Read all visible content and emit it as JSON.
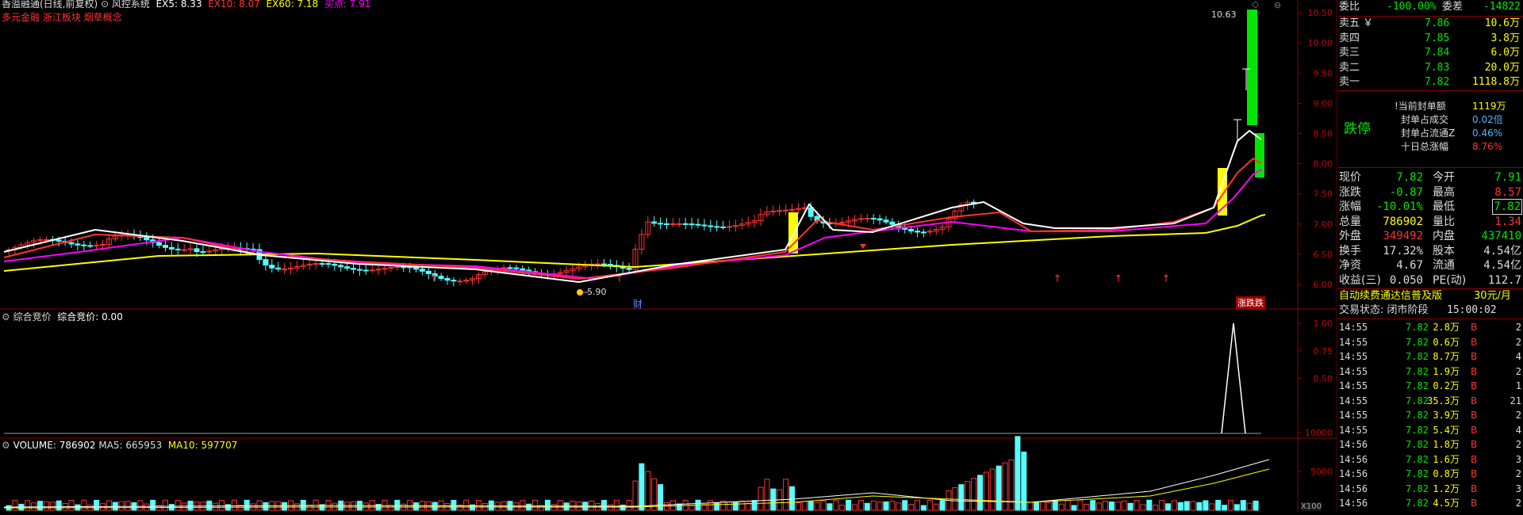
{
  "header": {
    "stock_name": "香溢融通(日线,前复权)",
    "system_icon_label": "风控系统",
    "ex5": "EX5: 8.33",
    "ex10": "EX10: 8.07",
    "ex60": "EX60: 7.18",
    "buy_sell": "买点: 7.91",
    "concepts": "多元金融 浙江板块 烟草概念"
  },
  "main_chart": {
    "y_ticks": [
      "10.50",
      "10.00",
      "9.50",
      "9.00",
      "8.50",
      "8.00",
      "7.50",
      "7.00",
      "6.50",
      "6.00"
    ],
    "high_label": "10.63",
    "low_label": "5.90",
    "cai_marker": "财",
    "limit_tag": "涨跌跌"
  },
  "auction_panel": {
    "title": "综合竞价",
    "value_label": "综合竞价: 0.00",
    "y_ticks": [
      "1.00",
      "0.75",
      "0.50"
    ]
  },
  "volume_panel": {
    "vol": "VOLUME: 786902",
    "ma5": "MA5: 665953",
    "ma10": "MA10: 597707",
    "y_ticks": [
      "10000",
      "5000"
    ],
    "unit": "X100"
  },
  "colors": {
    "up": "#ff3232",
    "down": "#54ffff",
    "ma5": "#ffffff",
    "ma10": "#ff3232",
    "ma20": "#ff00ff",
    "ma60": "#ffff00",
    "green": "#00e600"
  },
  "order_book": {
    "weibi_label": "委比",
    "weibi_value": "-100.00%",
    "weicha_label": "委差",
    "weicha_value": "-14822",
    "asks": [
      {
        "label": "卖五",
        "price": "7.86",
        "vol": "10.6万"
      },
      {
        "label": "卖四",
        "price": "7.85",
        "vol": "3.8万"
      },
      {
        "label": "卖三",
        "price": "7.84",
        "vol": "6.0万"
      },
      {
        "label": "卖二",
        "price": "7.83",
        "vol": "20.0万"
      },
      {
        "label": "卖一",
        "price": "7.82",
        "vol": "1118.8万"
      }
    ],
    "status_big": "跌停",
    "seal_info": [
      {
        "label": "当前封单额",
        "value": "1119万"
      },
      {
        "label": "封单占成交",
        "value": "0.02倍"
      },
      {
        "label": "封单占流通Z",
        "value": "0.46%"
      },
      {
        "label": "十日总涨幅",
        "value": "8.76%"
      }
    ]
  },
  "quote": {
    "rows": [
      {
        "l1": "现价",
        "v1": "7.82",
        "l2": "今开",
        "v2": "7.91"
      },
      {
        "l1": "涨跌",
        "v1": "-0.87",
        "l2": "最高",
        "v2": "8.57"
      },
      {
        "l1": "涨幅",
        "v1": "-10.01%",
        "l2": "最低",
        "v2": "7.82"
      },
      {
        "l1": "总量",
        "v1": "786902",
        "l2": "量比",
        "v2": "1.34"
      },
      {
        "l1": "外盘",
        "v1": "349492",
        "l2": "内盘",
        "v2": "437410"
      },
      {
        "l1": "换手",
        "v1": "17.32%",
        "l2": "股本",
        "v2": "4.54亿"
      },
      {
        "l1": "净资",
        "v1": "4.67",
        "l2": "流通",
        "v2": "4.54亿"
      },
      {
        "l1": "收益(三)",
        "v1": "0.050",
        "l2": "PE(动)",
        "v2": "112.7"
      }
    ]
  },
  "promo": {
    "text": "自动续费通达信普及版",
    "price": "30元/月"
  },
  "trade_status": {
    "label": "交易状态: 闭市阶段",
    "time": "15:00:02"
  },
  "ticks": [
    {
      "t": "14:55",
      "p": "7.82",
      "v": "2.8万",
      "d": "B",
      "n": "2"
    },
    {
      "t": "14:55",
      "p": "7.82",
      "v": "0.6万",
      "d": "B",
      "n": "2"
    },
    {
      "t": "14:55",
      "p": "7.82",
      "v": "8.7万",
      "d": "B",
      "n": "4"
    },
    {
      "t": "14:55",
      "p": "7.82",
      "v": "1.9万",
      "d": "B",
      "n": "2"
    },
    {
      "t": "14:55",
      "p": "7.82",
      "v": "0.2万",
      "d": "B",
      "n": "1"
    },
    {
      "t": "14:55",
      "p": "7.82",
      "v": "35.3万",
      "d": "B",
      "n": "21"
    },
    {
      "t": "14:55",
      "p": "7.82",
      "v": "3.9万",
      "d": "B",
      "n": "2"
    },
    {
      "t": "14:55",
      "p": "7.82",
      "v": "5.4万",
      "d": "B",
      "n": "4"
    },
    {
      "t": "14:56",
      "p": "7.82",
      "v": "1.8万",
      "d": "B",
      "n": "2"
    },
    {
      "t": "14:56",
      "p": "7.82",
      "v": "1.6万",
      "d": "B",
      "n": "3"
    },
    {
      "t": "14:56",
      "p": "7.82",
      "v": "0.8万",
      "d": "B",
      "n": "2"
    },
    {
      "t": "14:56",
      "p": "7.82",
      "v": "1.2万",
      "d": "B",
      "n": "3"
    },
    {
      "t": "14:56",
      "p": "7.82",
      "v": "4.5万",
      "d": "B",
      "n": "2"
    }
  ]
}
